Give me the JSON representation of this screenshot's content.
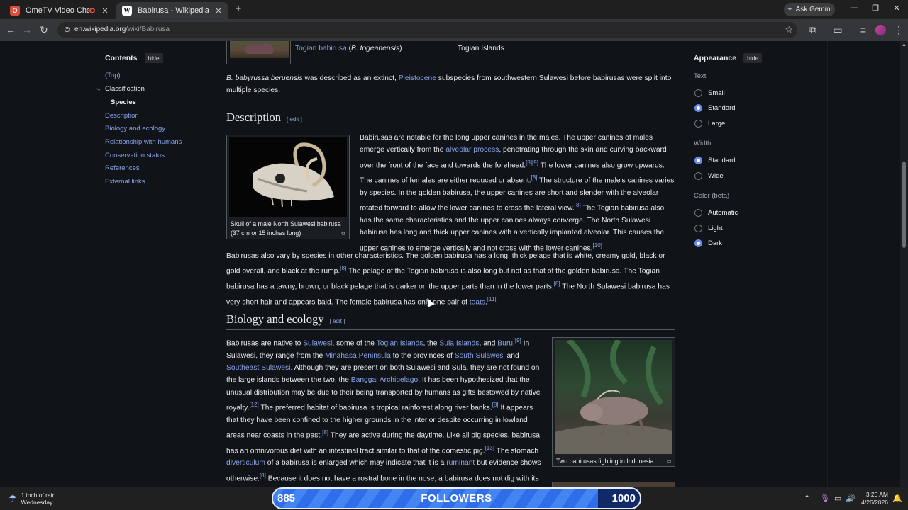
{
  "browser": {
    "tabs": [
      {
        "title": "OmeTV Video Chat — Ome",
        "favicon": "O"
      },
      {
        "title": "Babirusa - Wikipedia",
        "favicon": "W"
      }
    ],
    "ask_gemini": "Ask Gemini",
    "url_host": "en.wikipedia.org",
    "url_path": "/wiki/Babirusa"
  },
  "toc": {
    "title": "Contents",
    "hide": "hide",
    "items": [
      {
        "label": "(Top)"
      },
      {
        "label": "Classification"
      },
      {
        "label": "Species"
      },
      {
        "label": "Description"
      },
      {
        "label": "Biology and ecology"
      },
      {
        "label": "Relationship with humans"
      },
      {
        "label": "Conservation status"
      },
      {
        "label": "References"
      },
      {
        "label": "External links"
      }
    ]
  },
  "appearance": {
    "title": "Appearance",
    "hide": "hide",
    "text_label": "Text",
    "text_options": [
      "Small",
      "Standard",
      "Large"
    ],
    "width_label": "Width",
    "width_options": [
      "Standard",
      "Wide"
    ],
    "color_label": "Color (beta)",
    "color_options": [
      "Automatic",
      "Light",
      "Dark"
    ]
  },
  "content": {
    "species_row": {
      "name_link": "Togian babirusa",
      "sci_name": "B. togeanensis",
      "range": "Togian Islands"
    },
    "p_subspecies_sci": "B. babyrussa beruensis",
    "p_subspecies_a": " was described as an extinct, ",
    "p_subspecies_link": "Pleistocene",
    "p_subspecies_b": " subspecies from southwestern Sulawesi before babirusas were split into multiple species.",
    "h_description": "Description",
    "edit": "edit",
    "fig_skull_caption": "Skull of a male North Sulawesi babirusa (37 cm or 15 inches long)",
    "desc1": {
      "a": "Babirusas are notable for the long upper canines in the males. The upper canines of males emerge vertically from the ",
      "link": "alveolar process",
      "b": ", penetrating through the skin and curving backward over the front of the face and towards the forehead.",
      "r1": "[8][9]",
      "c": " The lower canines also grow upwards. The canines of females are either reduced or absent.",
      "r2": "[8]",
      "d": " The structure of the male's canines varies by species. In the golden babirusa, the upper canines are short and slender with the alveolar rotated forward to allow the lower canines to cross the lateral view.",
      "r3": "[8]",
      "e": " The Togian babirusa also has the same characteristics and the upper canines always converge. The North Sulawesi babirusa has long and thick upper canines with a vertically implanted alveolar. This causes the upper canines to emerge vertically and not cross with the lower canines.",
      "r4": "[10]"
    },
    "desc2": {
      "a": "Babirusas also vary by species in other characteristics. The golden babirusa has a long, thick pelage that is white, creamy gold, black or gold overall, and black at the rump.",
      "r1": "[8]",
      "b": " The pelage of the Togian babirusa is also long but not as that of the golden babirusa. The Togian babirusa has a tawny, brown, or black pelage that is darker on the upper parts than in the lower parts.",
      "r2": "[8]",
      "c": " The North Sulawesi babirusa has very short hair and appears bald. The female babirusa has only one pair of ",
      "link": "teats",
      "d": ".",
      "r3": "[11]"
    },
    "h_biology": "Biology and ecology",
    "fig_fight_caption": "Two babirusas fighting in Indonesia",
    "bio1": {
      "a": "Babirusas are native to ",
      "l1": "Sulawesi",
      "b": ", some of the ",
      "l2": "Togian Islands",
      "c": ", the ",
      "l3": "Sula Islands",
      "d": ", and ",
      "l4": "Buru",
      "e": ".",
      "r1": "[9]",
      "f": " In Sulawesi, they range from the ",
      "l5": "Minahasa Peninsula",
      "g": " to the provinces of ",
      "l6": "South Sulawesi",
      "h": " and ",
      "l7": "Southeast Sulawesi",
      "i": ". Although they are present on both Sulawesi and Sula, they are not found on the large islands between the two, the ",
      "l8": "Banggai Archipelago",
      "j": ". It has been hypothesized that the unusual distribution may be due to their being transported by humans as gifts bestowed by native royalty.",
      "r2": "[12]",
      "k": " The preferred habitat of babirusa is tropical rainforest along river banks.",
      "r3": "[8]",
      "l": " It appears that they have been confined to the higher grounds in the interior despite occurring in lowland areas near coasts in the past.",
      "r4": "[8]",
      "m": " They are active during the daytime. Like all pig species, babirusa has an omnivorous diet with an intestinal tract similar to that of the domestic pig.",
      "r5": "[13]",
      "n": " The stomach ",
      "l9": "diverticulum",
      "o": " of a babirusa is enlarged which may indicate that it is a ",
      "l10": "ruminant",
      "p": " but evidence shows otherwise.",
      "r6": "[8]",
      "q": " Because it does not have a rostral bone in the nose, a babirusa does not dig with its snout like other pigs do except in mud and swampy grounds. The diet of the babirusa includes"
    }
  },
  "taskbar": {
    "weather_line1": "1 inch of rain",
    "weather_line2": "Wednesday",
    "followers_current": "885",
    "followers_label": "FOLLOWERS",
    "followers_goal": "1000",
    "followers_progress": 0.885,
    "time": "3:20 AM",
    "date": "4/26/2026"
  },
  "colors": {
    "link": "#88a3e8",
    "background": "#101418",
    "progress": "#2f6ee8"
  }
}
